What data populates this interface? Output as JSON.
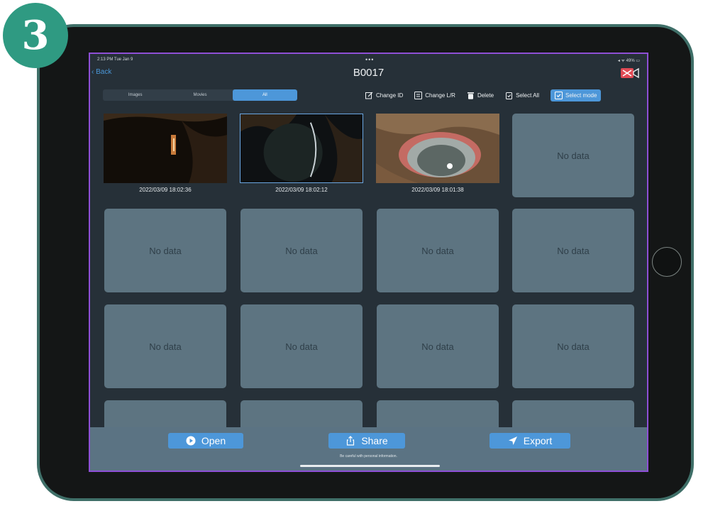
{
  "step_badge": "3",
  "status_bar": {
    "time": "2:13 PM  Tue Jan 9",
    "dots": "•••",
    "right": "◂ ᯤ 49% ▭"
  },
  "nav": {
    "back": "‹ Back",
    "title": "B0017",
    "video_icon": "video-off-icon"
  },
  "segments": [
    {
      "label": "Images",
      "active": false
    },
    {
      "label": "Movies",
      "active": false
    },
    {
      "label": "All",
      "active": true
    }
  ],
  "toolbar": {
    "change_id": "Change ID",
    "change_lr": "Change L/R",
    "delete": "Delete",
    "select_all": "Select All",
    "select_mode": "Select mode"
  },
  "photos": [
    {
      "timestamp": "2022/03/09 18:02:36",
      "selected": false
    },
    {
      "timestamp": "2022/03/09 18:02:12",
      "selected": true
    },
    {
      "timestamp": "2022/03/09 18:01:38",
      "selected": false
    }
  ],
  "no_data_label": "No data",
  "bottom": {
    "open": "Open",
    "share": "Share",
    "export": "Export",
    "warning": "Be careful with personal information."
  },
  "colors": {
    "accent": "#4d97d9",
    "screen_bg": "#263038",
    "tile_bg": "#5d7481",
    "tablet_frame": "#3f6f68",
    "badge": "#2f9a82",
    "screen_outline": "#8e4fd6"
  }
}
